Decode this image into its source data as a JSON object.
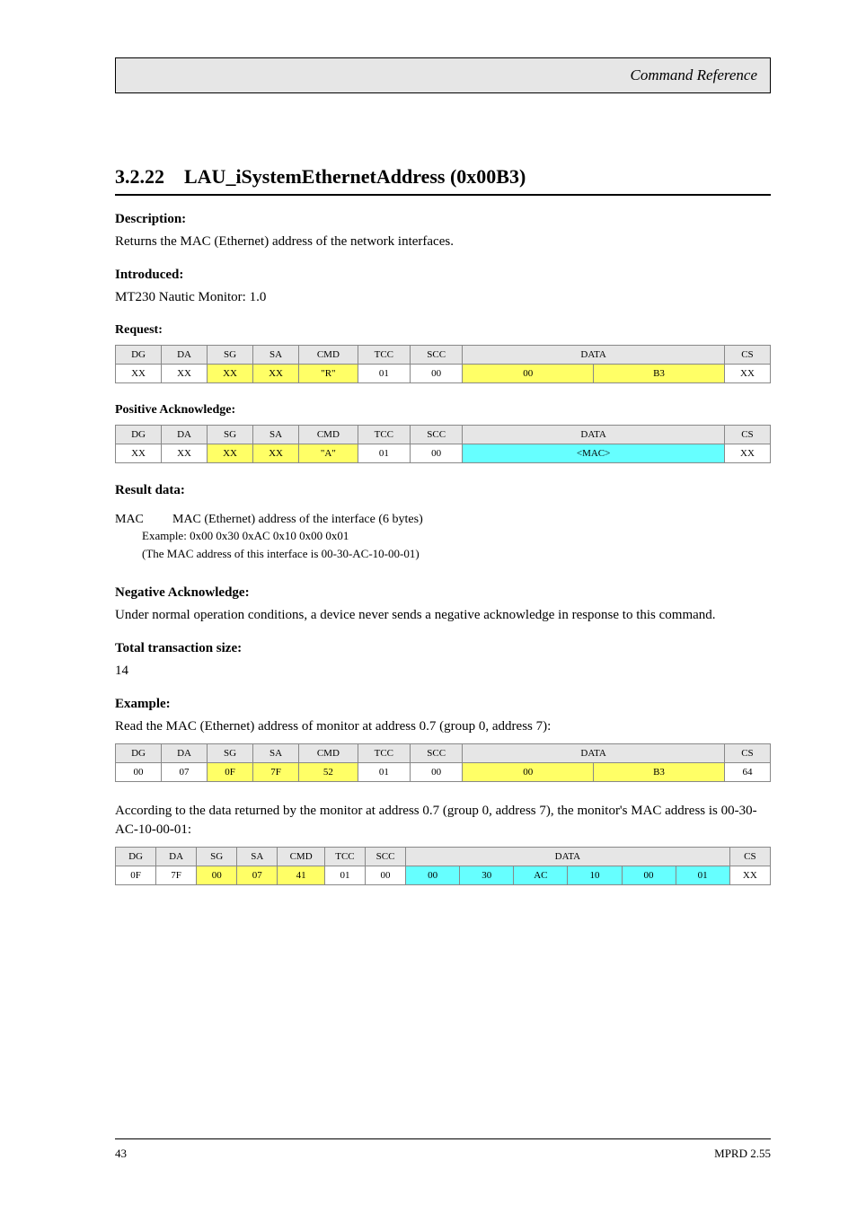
{
  "header": {
    "title": "Command Reference"
  },
  "section": {
    "number": "3.2.22",
    "name": "LAU_iSystemEthernetAddress (0x00B3)",
    "desc_label": "Description:",
    "desc_text": "Returns the MAC (Ethernet) address of the network interfaces.",
    "intro_label": "Introduced:",
    "intro_text": "MT230 Nautic Monitor: 1.0"
  },
  "req": {
    "label": "Request:",
    "headers": [
      "DG",
      "DA",
      "SG",
      "SA",
      "CMD",
      "TCC",
      "SCC",
      "DATA",
      "CS"
    ],
    "row": {
      "dg": "XX",
      "da": "XX",
      "sg": "XX",
      "sa": "XX",
      "cmd": "\"R\"",
      "tcc": "01",
      "scc": "00",
      "data_a": "00",
      "data_b": "B3",
      "cs": "XX"
    }
  },
  "pack": {
    "label": "Positive Acknowledge:",
    "headers": [
      "DG",
      "DA",
      "SG",
      "SA",
      "CMD",
      "TCC",
      "SCC",
      "DATA",
      "CS"
    ],
    "row": {
      "dg": "XX",
      "da": "XX",
      "sg": "XX",
      "sa": "XX",
      "cmd": "\"A\"",
      "tcc": "01",
      "scc": "00",
      "data": "<MAC>",
      "cs": "XX"
    }
  },
  "result": {
    "label": "Result data:",
    "param_name": "MAC",
    "param_desc": "MAC (Ethernet) address of the interface (6 bytes)",
    "example_label": "Example:",
    "example_val": "0x00 0x30 0xAC 0x10 0x00 0x01",
    "example_note": "(The MAC address of this interface is 00-30-AC-10-00-01)"
  },
  "nack": {
    "label": "Negative Acknowledge:",
    "text": "Under normal operation conditions, a device never sends a negative acknowledge in response to this command."
  },
  "tx": {
    "label": "Total transaction size:",
    "value": "14"
  },
  "example": {
    "label": "Example:",
    "intro": "Read the MAC (Ethernet) address of monitor at address 0.7 (group 0, address 7):",
    "table1_headers": [
      "DG",
      "DA",
      "SG",
      "SA",
      "CMD",
      "TCC",
      "SCC",
      "DATA",
      "CS"
    ],
    "table1_row": {
      "dg": "00",
      "da": "07",
      "sg": "0F",
      "sa": "7F",
      "cmd": "52",
      "tcc": "01",
      "scc": "00",
      "d1": "00",
      "d2": "B3",
      "cs": "64"
    },
    "mid_text": "According to the data returned by the monitor at address 0.7 (group 0, address 7), the monitor's MAC address is 00-30-AC-10-00-01:",
    "table2_headers": [
      "DG",
      "DA",
      "SG",
      "SA",
      "CMD",
      "TCC",
      "SCC",
      "DATA",
      "CS"
    ],
    "table2_row": {
      "dg": "0F",
      "da": "7F",
      "sg": "00",
      "sa": "07",
      "cmd": "41",
      "tcc": "01",
      "scc": "00",
      "m1": "00",
      "m2": "30",
      "m3": "AC",
      "m4": "10",
      "m5": "00",
      "m6": "01",
      "cs": "XX"
    }
  },
  "footer": {
    "left": "43",
    "right": "MPRD 2.55"
  }
}
